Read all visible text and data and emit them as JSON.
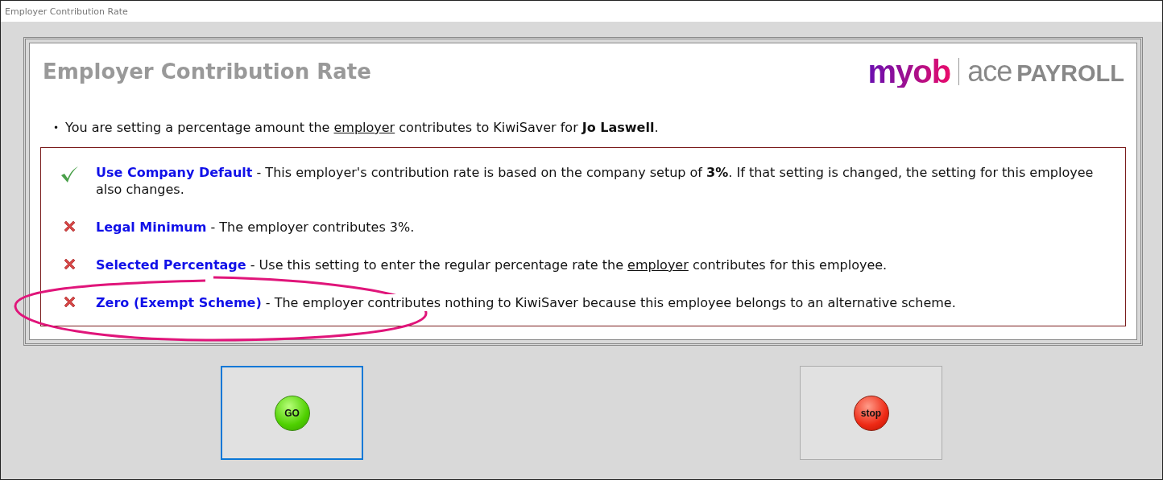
{
  "window": {
    "title": "Employer Contribution Rate"
  },
  "header": {
    "title": "Employer Contribution Rate",
    "logo": {
      "brand": "myob",
      "product_light": "ace",
      "product_bold": "PAYROLL"
    }
  },
  "intro": {
    "bullet": "•",
    "parts": [
      {
        "text": "You are setting a percentage amount the ",
        "kind": "plain"
      },
      {
        "text": "employer",
        "kind": "underline"
      },
      {
        "text": " contributes to KiwiSaver for ",
        "kind": "plain"
      },
      {
        "text": "Jo Laswell",
        "kind": "bold"
      },
      {
        "text": ".",
        "kind": "plain"
      }
    ]
  },
  "options": [
    {
      "kind": "check",
      "label": "Use Company Default",
      "description": [
        {
          "text": " - This employer's contribution rate is based on the company setup of ",
          "kind": "plain"
        },
        {
          "text": "3%",
          "kind": "bold"
        },
        {
          "text": ". If that setting is changed, the setting for this employee also changes.",
          "kind": "plain"
        }
      ]
    },
    {
      "kind": "cross",
      "label": "Legal Minimum",
      "description": [
        {
          "text": " - The employer contributes 3%.",
          "kind": "plain"
        }
      ]
    },
    {
      "kind": "cross",
      "label": "Selected Percentage",
      "description": [
        {
          "text": " - Use this setting to enter the regular percentage rate the ",
          "kind": "plain"
        },
        {
          "text": "employer",
          "kind": "underline"
        },
        {
          "text": " contributes for this employee.",
          "kind": "plain"
        }
      ]
    },
    {
      "kind": "cross",
      "label": "Zero (Exempt Scheme)",
      "description": [
        {
          "text": " - The employer contributes nothing to KiwiSaver because this employee belongs to an alternative scheme.",
          "kind": "plain"
        }
      ]
    }
  ],
  "buttons": [
    {
      "label": "GO",
      "kind": "go",
      "selected": true
    },
    {
      "label": "stop",
      "kind": "stop",
      "selected": false
    }
  ]
}
